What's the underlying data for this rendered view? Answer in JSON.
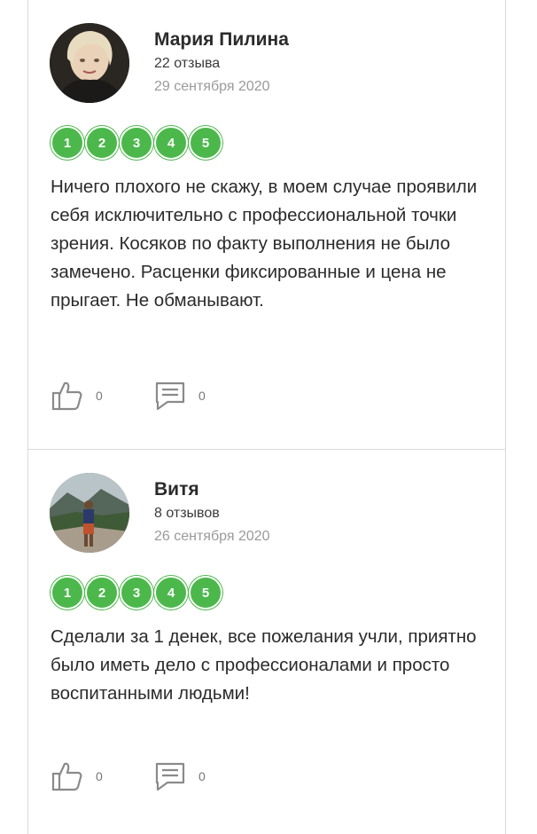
{
  "colors": {
    "accent": "#4cb84c",
    "border": "#dadada",
    "muted": "#9a9a9a"
  },
  "reviews": [
    {
      "name": "Мария Пилина",
      "reviews_count": "22 отзыва",
      "date": "29 сентября 2020",
      "rating": [
        "1",
        "2",
        "3",
        "4",
        "5"
      ],
      "text": "Ничего плохого не скажу, в моем случае проявили себя исключительно с профессиональной точки зрения. Косяков по факту выполнения не было замечено. Расценки фиксированные и цена не прыгает. Не обманывают.",
      "likes": "0",
      "comments": "0",
      "icons": {
        "like": "thumbs-up-icon",
        "comment": "comment-icon"
      }
    },
    {
      "name": "Витя",
      "reviews_count": "8 отзывов",
      "date": "26 сентября 2020",
      "rating": [
        "1",
        "2",
        "3",
        "4",
        "5"
      ],
      "text": "Сделали за 1 денек, все пожелания учли, приятно было иметь дело с профессионалами и просто воспитанными людьми!",
      "likes": "0",
      "comments": "0",
      "icons": {
        "like": "thumbs-up-icon",
        "comment": "comment-icon"
      }
    }
  ]
}
